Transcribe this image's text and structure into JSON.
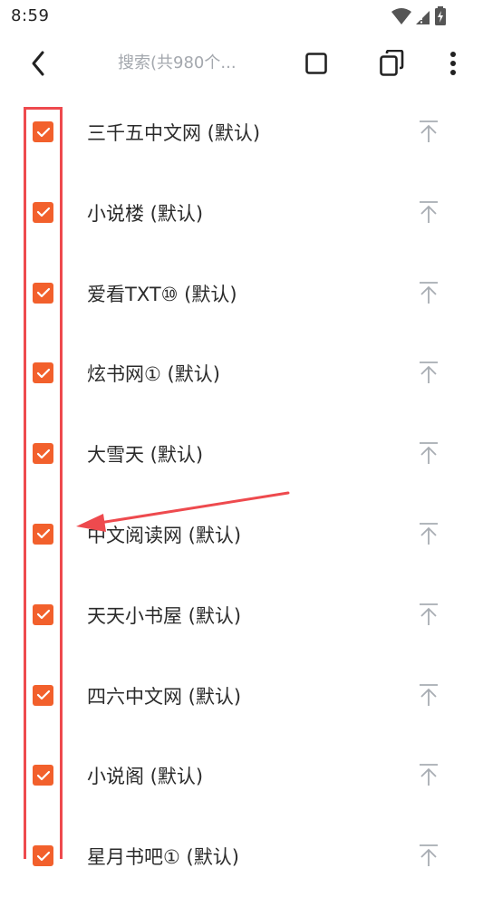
{
  "status_bar": {
    "time": "8:59"
  },
  "toolbar": {
    "search_placeholder": "搜索(共980个..."
  },
  "sources": [
    {
      "label": "三千五中文网 (默认)",
      "checked": true
    },
    {
      "label": "小说楼 (默认)",
      "checked": true
    },
    {
      "label": "爱看TXT⑩ (默认)",
      "checked": true
    },
    {
      "label": "炫书网① (默认)",
      "checked": true
    },
    {
      "label": "大雪天 (默认)",
      "checked": true
    },
    {
      "label": "中文阅读网 (默认)",
      "checked": true
    },
    {
      "label": "天天小书屋 (默认)",
      "checked": true
    },
    {
      "label": "四六中文网 (默认)",
      "checked": true
    },
    {
      "label": "小说阁 (默认)",
      "checked": true
    },
    {
      "label": "星月书吧① (默认)",
      "checked": true
    }
  ],
  "colors": {
    "checkbox": "#f2602c",
    "annotation": "#ee4a4e"
  }
}
